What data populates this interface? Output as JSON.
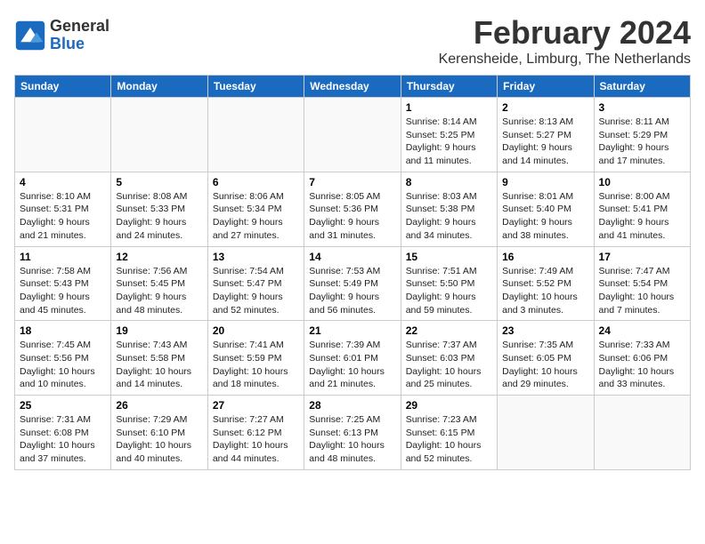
{
  "logo": {
    "general": "General",
    "blue": "Blue"
  },
  "title": "February 2024",
  "location": "Kerensheide, Limburg, The Netherlands",
  "weekdays": [
    "Sunday",
    "Monday",
    "Tuesday",
    "Wednesday",
    "Thursday",
    "Friday",
    "Saturday"
  ],
  "weeks": [
    [
      {
        "day": "",
        "info": ""
      },
      {
        "day": "",
        "info": ""
      },
      {
        "day": "",
        "info": ""
      },
      {
        "day": "",
        "info": ""
      },
      {
        "day": "1",
        "info": "Sunrise: 8:14 AM\nSunset: 5:25 PM\nDaylight: 9 hours\nand 11 minutes."
      },
      {
        "day": "2",
        "info": "Sunrise: 8:13 AM\nSunset: 5:27 PM\nDaylight: 9 hours\nand 14 minutes."
      },
      {
        "day": "3",
        "info": "Sunrise: 8:11 AM\nSunset: 5:29 PM\nDaylight: 9 hours\nand 17 minutes."
      }
    ],
    [
      {
        "day": "4",
        "info": "Sunrise: 8:10 AM\nSunset: 5:31 PM\nDaylight: 9 hours\nand 21 minutes."
      },
      {
        "day": "5",
        "info": "Sunrise: 8:08 AM\nSunset: 5:33 PM\nDaylight: 9 hours\nand 24 minutes."
      },
      {
        "day": "6",
        "info": "Sunrise: 8:06 AM\nSunset: 5:34 PM\nDaylight: 9 hours\nand 27 minutes."
      },
      {
        "day": "7",
        "info": "Sunrise: 8:05 AM\nSunset: 5:36 PM\nDaylight: 9 hours\nand 31 minutes."
      },
      {
        "day": "8",
        "info": "Sunrise: 8:03 AM\nSunset: 5:38 PM\nDaylight: 9 hours\nand 34 minutes."
      },
      {
        "day": "9",
        "info": "Sunrise: 8:01 AM\nSunset: 5:40 PM\nDaylight: 9 hours\nand 38 minutes."
      },
      {
        "day": "10",
        "info": "Sunrise: 8:00 AM\nSunset: 5:41 PM\nDaylight: 9 hours\nand 41 minutes."
      }
    ],
    [
      {
        "day": "11",
        "info": "Sunrise: 7:58 AM\nSunset: 5:43 PM\nDaylight: 9 hours\nand 45 minutes."
      },
      {
        "day": "12",
        "info": "Sunrise: 7:56 AM\nSunset: 5:45 PM\nDaylight: 9 hours\nand 48 minutes."
      },
      {
        "day": "13",
        "info": "Sunrise: 7:54 AM\nSunset: 5:47 PM\nDaylight: 9 hours\nand 52 minutes."
      },
      {
        "day": "14",
        "info": "Sunrise: 7:53 AM\nSunset: 5:49 PM\nDaylight: 9 hours\nand 56 minutes."
      },
      {
        "day": "15",
        "info": "Sunrise: 7:51 AM\nSunset: 5:50 PM\nDaylight: 9 hours\nand 59 minutes."
      },
      {
        "day": "16",
        "info": "Sunrise: 7:49 AM\nSunset: 5:52 PM\nDaylight: 10 hours\nand 3 minutes."
      },
      {
        "day": "17",
        "info": "Sunrise: 7:47 AM\nSunset: 5:54 PM\nDaylight: 10 hours\nand 7 minutes."
      }
    ],
    [
      {
        "day": "18",
        "info": "Sunrise: 7:45 AM\nSunset: 5:56 PM\nDaylight: 10 hours\nand 10 minutes."
      },
      {
        "day": "19",
        "info": "Sunrise: 7:43 AM\nSunset: 5:58 PM\nDaylight: 10 hours\nand 14 minutes."
      },
      {
        "day": "20",
        "info": "Sunrise: 7:41 AM\nSunset: 5:59 PM\nDaylight: 10 hours\nand 18 minutes."
      },
      {
        "day": "21",
        "info": "Sunrise: 7:39 AM\nSunset: 6:01 PM\nDaylight: 10 hours\nand 21 minutes."
      },
      {
        "day": "22",
        "info": "Sunrise: 7:37 AM\nSunset: 6:03 PM\nDaylight: 10 hours\nand 25 minutes."
      },
      {
        "day": "23",
        "info": "Sunrise: 7:35 AM\nSunset: 6:05 PM\nDaylight: 10 hours\nand 29 minutes."
      },
      {
        "day": "24",
        "info": "Sunrise: 7:33 AM\nSunset: 6:06 PM\nDaylight: 10 hours\nand 33 minutes."
      }
    ],
    [
      {
        "day": "25",
        "info": "Sunrise: 7:31 AM\nSunset: 6:08 PM\nDaylight: 10 hours\nand 37 minutes."
      },
      {
        "day": "26",
        "info": "Sunrise: 7:29 AM\nSunset: 6:10 PM\nDaylight: 10 hours\nand 40 minutes."
      },
      {
        "day": "27",
        "info": "Sunrise: 7:27 AM\nSunset: 6:12 PM\nDaylight: 10 hours\nand 44 minutes."
      },
      {
        "day": "28",
        "info": "Sunrise: 7:25 AM\nSunset: 6:13 PM\nDaylight: 10 hours\nand 48 minutes."
      },
      {
        "day": "29",
        "info": "Sunrise: 7:23 AM\nSunset: 6:15 PM\nDaylight: 10 hours\nand 52 minutes."
      },
      {
        "day": "",
        "info": ""
      },
      {
        "day": "",
        "info": ""
      }
    ]
  ]
}
